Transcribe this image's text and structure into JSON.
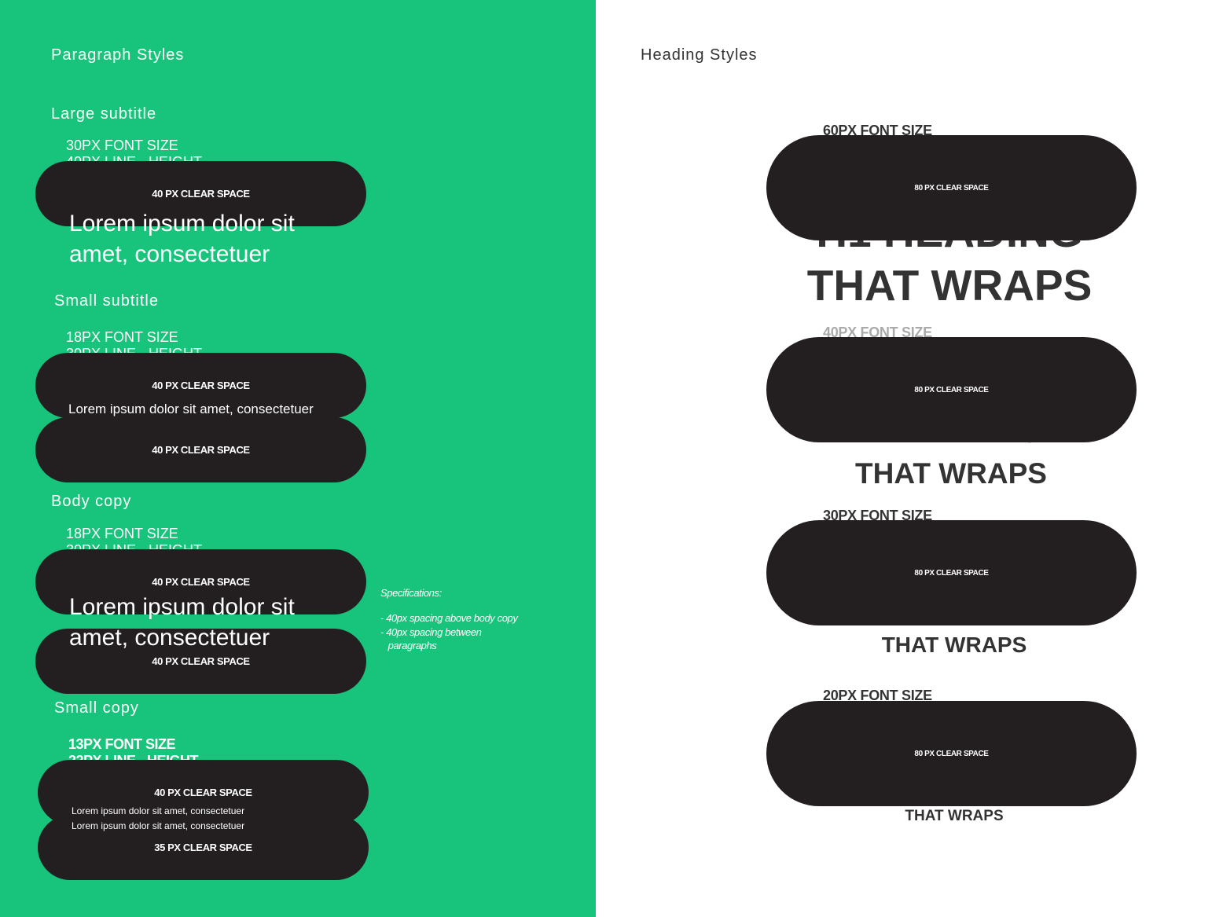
{
  "paragraph": {
    "title": "Paragraph Styles",
    "large_subtitle": {
      "heading": "Large subtitle",
      "font_size": "30PX FONT SIZE",
      "line_height": "40PX LINE - HEIGHT",
      "pill": "40 PX CLEAR SPACE",
      "sample_line1": "Lorem ipsum dolor sit",
      "sample_line2": "amet, consectetuer"
    },
    "small_subtitle": {
      "heading": "Small subtitle",
      "font_size": "18PX FONT SIZE",
      "line_height": "30PX LINE - HEIGHT",
      "pill_top": "40 PX CLEAR SPACE",
      "sample": "Lorem ipsum dolor sit amet, consectetuer",
      "pill_bottom": "40 PX CLEAR SPACE"
    },
    "body_copy": {
      "heading": "Body copy",
      "font_size": "18PX FONT SIZE",
      "line_height": "30PX LINE - HEIGHT",
      "pill_top": "40 PX CLEAR SPACE",
      "sample_line1": "Lorem ipsum dolor sit",
      "sample_line2": "amet, consectetuer",
      "pill_bottom": "40 PX CLEAR SPACE"
    },
    "specifications": {
      "title": "Specifications:",
      "lines": "- 40px spacing above body copy\n- 40px spacing between\n   paragraphs"
    },
    "small_copy": {
      "heading": "Small copy",
      "font_size": "13PX FONT SIZE",
      "line_height": "22PX LINE - HEIGHT",
      "pill_top": "40 PX CLEAR SPACE",
      "sample_line1": "Lorem ipsum dolor sit amet, consectetuer",
      "sample_line2": "Lorem ipsum dolor sit amet, consectetuer",
      "pill_bottom": "35 PX CLEAR SPACE"
    }
  },
  "heading": {
    "title": "Heading Styles",
    "h1": {
      "label": "60PX FONT SIZE",
      "pill": "80 PX CLEAR SPACE",
      "line1": "H1 HEADING",
      "line2": "THAT WRAPS"
    },
    "h2": {
      "label": "40PX FONT SIZE",
      "pill": "80 PX CLEAR SPACE",
      "line1": "H2 HEADING",
      "line2": "THAT WRAPS"
    },
    "h3": {
      "label": "30PX FONT SIZE",
      "pill": "80 PX CLEAR SPACE",
      "line2": "THAT WRAPS"
    },
    "h4": {
      "label": "20PX FONT SIZE",
      "pill": "80 PX CLEAR SPACE",
      "line2": "THAT WRAPS"
    }
  },
  "colors": {
    "green_panel": "#18c47b",
    "pill": "#231f20",
    "heading_text": "#333333",
    "muted_label": "#aaaaaa"
  }
}
